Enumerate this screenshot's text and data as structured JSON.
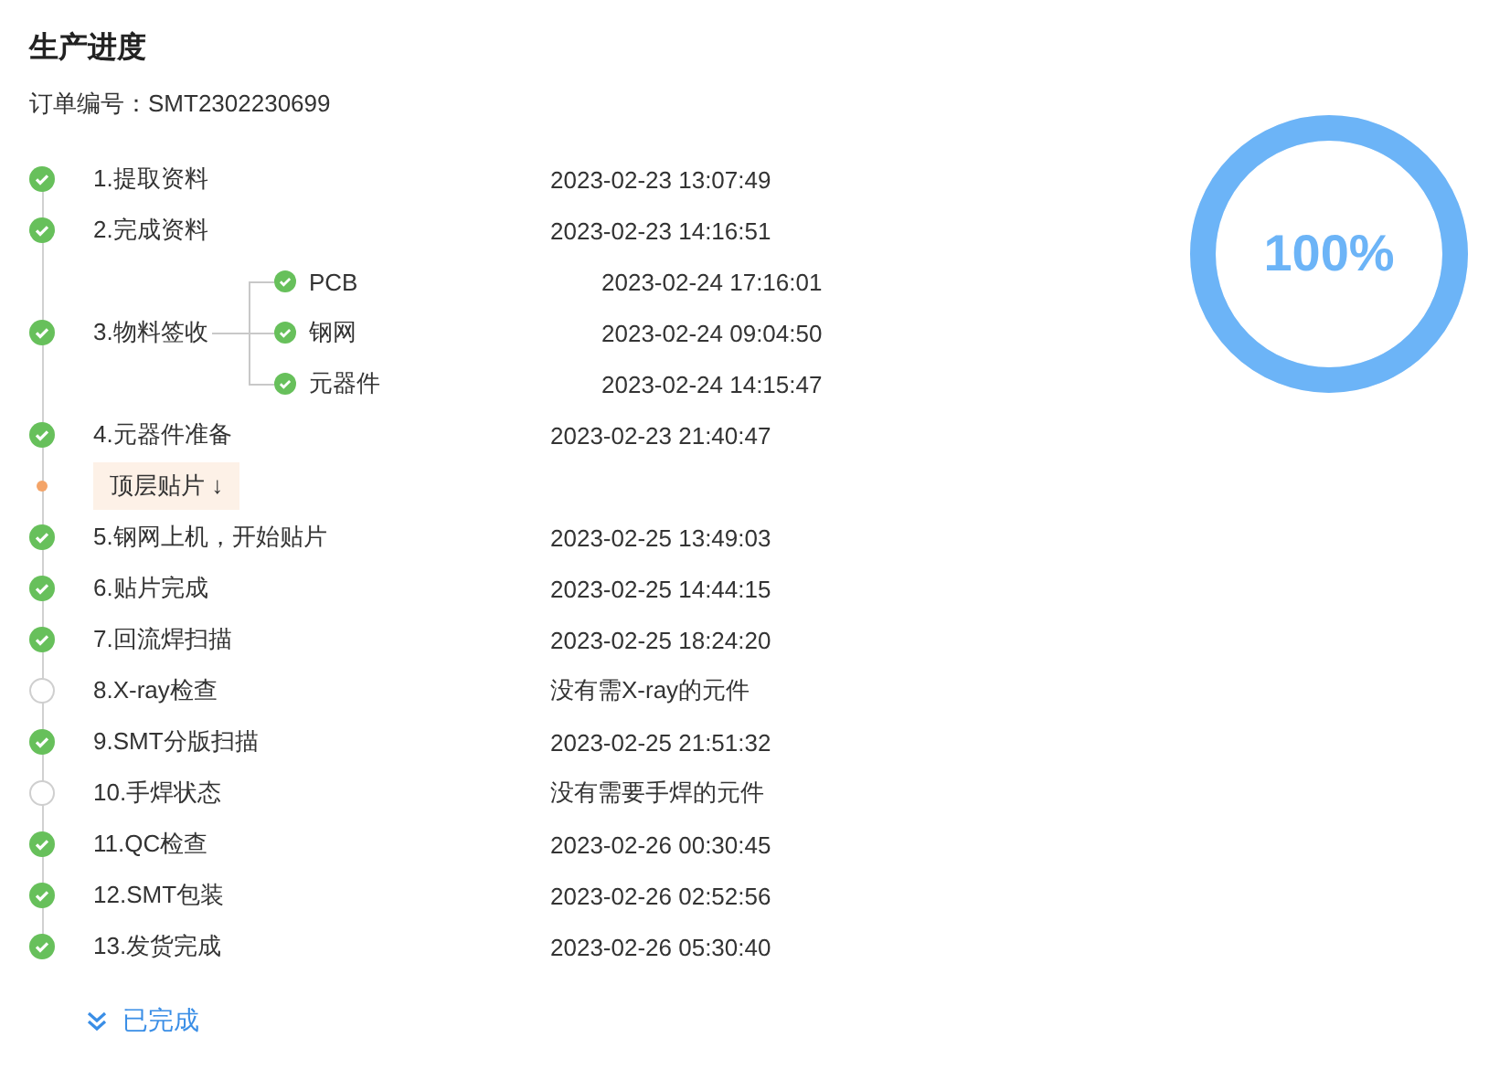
{
  "title": "生产进度",
  "order": {
    "label": "订单编号：",
    "number": "SMT2302230699"
  },
  "steps": [
    {
      "kind": "step",
      "label": "1.提取资料",
      "time": "2023-02-23 13:07:49",
      "done": true
    },
    {
      "kind": "step",
      "label": "2.完成资料",
      "time": "2023-02-23 14:16:51",
      "done": true
    },
    {
      "kind": "group",
      "label": "3.物料签收",
      "done": true,
      "children": [
        {
          "label": "PCB",
          "time": "2023-02-24 17:16:01",
          "done": true
        },
        {
          "label": "钢网",
          "time": "2023-02-24 09:04:50",
          "done": true
        },
        {
          "label": "元器件",
          "time": "2023-02-24 14:15:47",
          "done": true
        }
      ]
    },
    {
      "kind": "step",
      "label": "4.元器件准备",
      "time": "2023-02-23 21:40:47",
      "done": true
    },
    {
      "kind": "current",
      "label": "顶层贴片 ↓"
    },
    {
      "kind": "step",
      "label": "5.钢网上机，开始贴片",
      "time": "2023-02-25 13:49:03",
      "done": true
    },
    {
      "kind": "step",
      "label": "6.贴片完成",
      "time": "2023-02-25 14:44:15",
      "done": true
    },
    {
      "kind": "step",
      "label": "7.回流焊扫描",
      "time": "2023-02-25 18:24:20",
      "done": true
    },
    {
      "kind": "step",
      "label": "8.X-ray检查",
      "time": "没有需X-ray的元件",
      "done": false
    },
    {
      "kind": "step",
      "label": "9.SMT分版扫描",
      "time": "2023-02-25 21:51:32",
      "done": true
    },
    {
      "kind": "step",
      "label": "10.手焊状态",
      "time": "没有需要手焊的元件",
      "done": false
    },
    {
      "kind": "step",
      "label": "11.QC检查",
      "time": "2023-02-26 00:30:45",
      "done": true
    },
    {
      "kind": "step",
      "label": "12.SMT包装",
      "time": "2023-02-26 02:52:56",
      "done": true
    },
    {
      "kind": "step",
      "label": "13.发货完成",
      "time": "2023-02-26 05:30:40",
      "done": true
    }
  ],
  "progress": {
    "level": 1,
    "reading": "100%"
  },
  "footer_link": "已完成"
}
